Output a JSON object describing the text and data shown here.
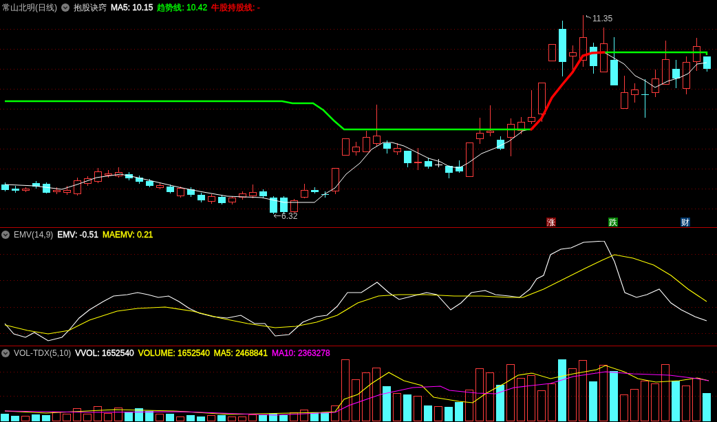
{
  "main_panel": {
    "stock_title": "常山北明(日线)",
    "indicator": "抱股诀窍",
    "readouts": [
      {
        "text": "MA5: 10.15",
        "color": "#ffffff"
      },
      {
        "text": "趋势线: 10.42",
        "color": "#00ff00"
      },
      {
        "text": "牛股持股线: -",
        "color": "#ff0000"
      }
    ],
    "price_labels": [
      {
        "kind": "high",
        "text": "11.35"
      },
      {
        "kind": "low",
        "text": "6.32"
      }
    ],
    "signals": [
      {
        "text": "涨",
        "color": "#800000"
      },
      {
        "text": "跌",
        "color": "#008000"
      },
      {
        "text": "财",
        "color": "#003a70"
      }
    ]
  },
  "emv_panel": {
    "indicator": "EMV(14,9)",
    "readouts": [
      {
        "text": "EMV: -0.51",
        "color": "#ffffff"
      },
      {
        "text": "MAEMV: 0.21",
        "color": "#ffff00"
      }
    ]
  },
  "volume_panel": {
    "indicator": "VOL-TDX(5,10)",
    "readouts": [
      {
        "text": "VVOL: 1652540",
        "color": "#ffffff"
      },
      {
        "text": "VOLUME: 1652540",
        "color": "#ffff00"
      },
      {
        "text": "MA5: 2468841",
        "color": "#ffff00"
      },
      {
        "text": "MA10: 2363278",
        "color": "#ff00ff"
      }
    ]
  }
}
